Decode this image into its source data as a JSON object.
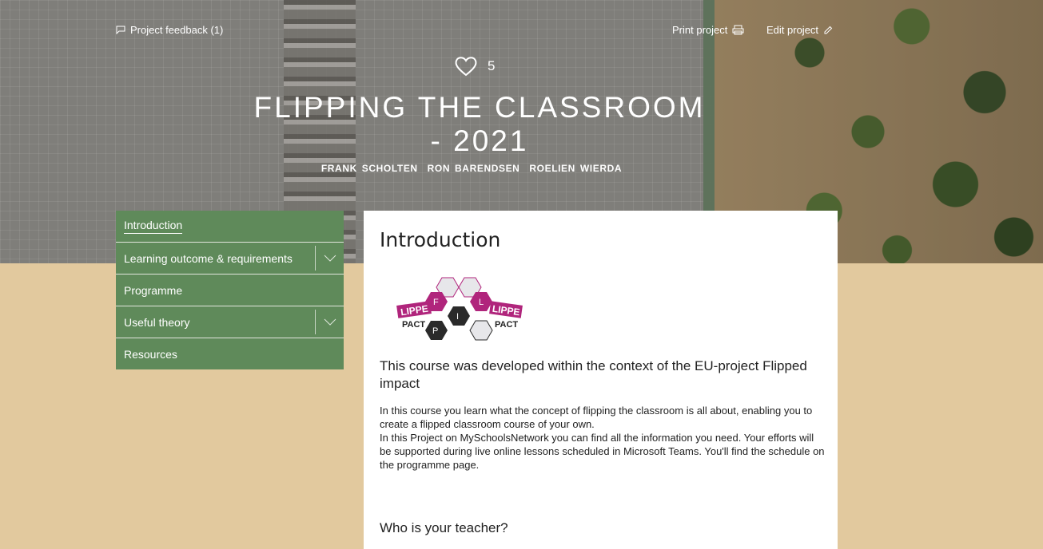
{
  "header": {
    "feedback_label": "Project feedback (1)",
    "print_label": "Print project",
    "edit_label": "Edit project",
    "likes_count": "5",
    "title_line1": "FLIPPING THE CLASSROOM",
    "title_line2": "- 2021",
    "authors": [
      "FRANK SCHOLTEN",
      "RON BARENDSEN",
      "ROELIEN WIERDA"
    ]
  },
  "nav": {
    "items": [
      {
        "label": "Introduction",
        "active": true,
        "expandable": false
      },
      {
        "label": "Learning outcome & requirements",
        "active": false,
        "expandable": true
      },
      {
        "label": "Programme",
        "active": false,
        "expandable": false
      },
      {
        "label": "Useful theory",
        "active": false,
        "expandable": true
      },
      {
        "label": "Resources",
        "active": false,
        "expandable": false
      }
    ]
  },
  "main": {
    "heading": "Introduction",
    "logo": {
      "left_text": "LIPPE",
      "left_sub": "PACT",
      "right_text": "LIPPE",
      "right_sub": "PACT",
      "letters": [
        "F",
        "L",
        "I",
        "P"
      ],
      "colors": {
        "magenta": "#b0257c",
        "dark": "#2a2a2a"
      }
    },
    "subheading": "This course was developed within the context of the EU-project Flipped impact",
    "paragraph1": "In this course you learn what the concept of flipping the classroom is all about, enabling you  to create a flipped classroom course of your own.",
    "paragraph2": "In this Project on MySchoolsNetwork you can find all the information you need. Your efforts will be supported during live online lessons scheduled in Microsoft Teams. You'll find the schedule on the programme page.",
    "section_heading": "Who is your teacher?"
  },
  "colors": {
    "page_bg": "#e2c99e",
    "nav_bg": "#5f8a5a",
    "card_bg": "#ffffff"
  }
}
